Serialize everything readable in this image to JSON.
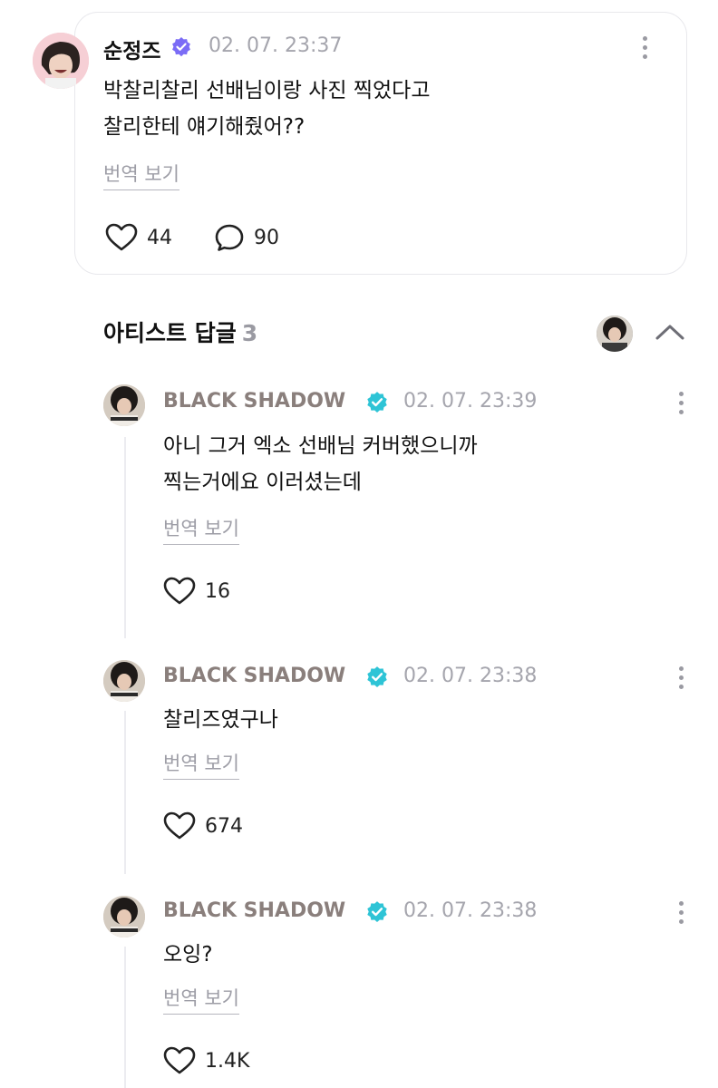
{
  "post": {
    "author": "순정즈",
    "timestamp": "02. 07. 23:37",
    "text_line1": "박찰리찰리 선배님이랑 사진 찍었다고",
    "text_line2": "찰리한테 얘기해줬어??",
    "translate_label": "번역 보기",
    "likes": "44",
    "comments": "90"
  },
  "artist_replies": {
    "title": "아티스트 답글",
    "count": "3"
  },
  "replies": [
    {
      "author": "BLACK SHADOW",
      "timestamp": "02. 07. 23:39",
      "text_line1": "아니 그거 엑소 선배님 커버했으니까",
      "text_line2": "찍는거에요 이러셨는데",
      "translate_label": "번역 보기",
      "likes": "16"
    },
    {
      "author": "BLACK SHADOW",
      "timestamp": "02. 07. 23:38",
      "text_line1": "찰리즈였구나",
      "translate_label": "번역 보기",
      "likes": "674"
    },
    {
      "author": "BLACK SHADOW",
      "timestamp": "02. 07. 23:38",
      "text_line1": "오잉?",
      "translate_label": "번역 보기",
      "likes": "1.4K"
    }
  ],
  "colors": {
    "fan_badge": "#7b6cf6",
    "artist_badge": "#2ec4d6",
    "artist_name": "#8a7f7c",
    "muted_text": "#a5a5ad"
  }
}
